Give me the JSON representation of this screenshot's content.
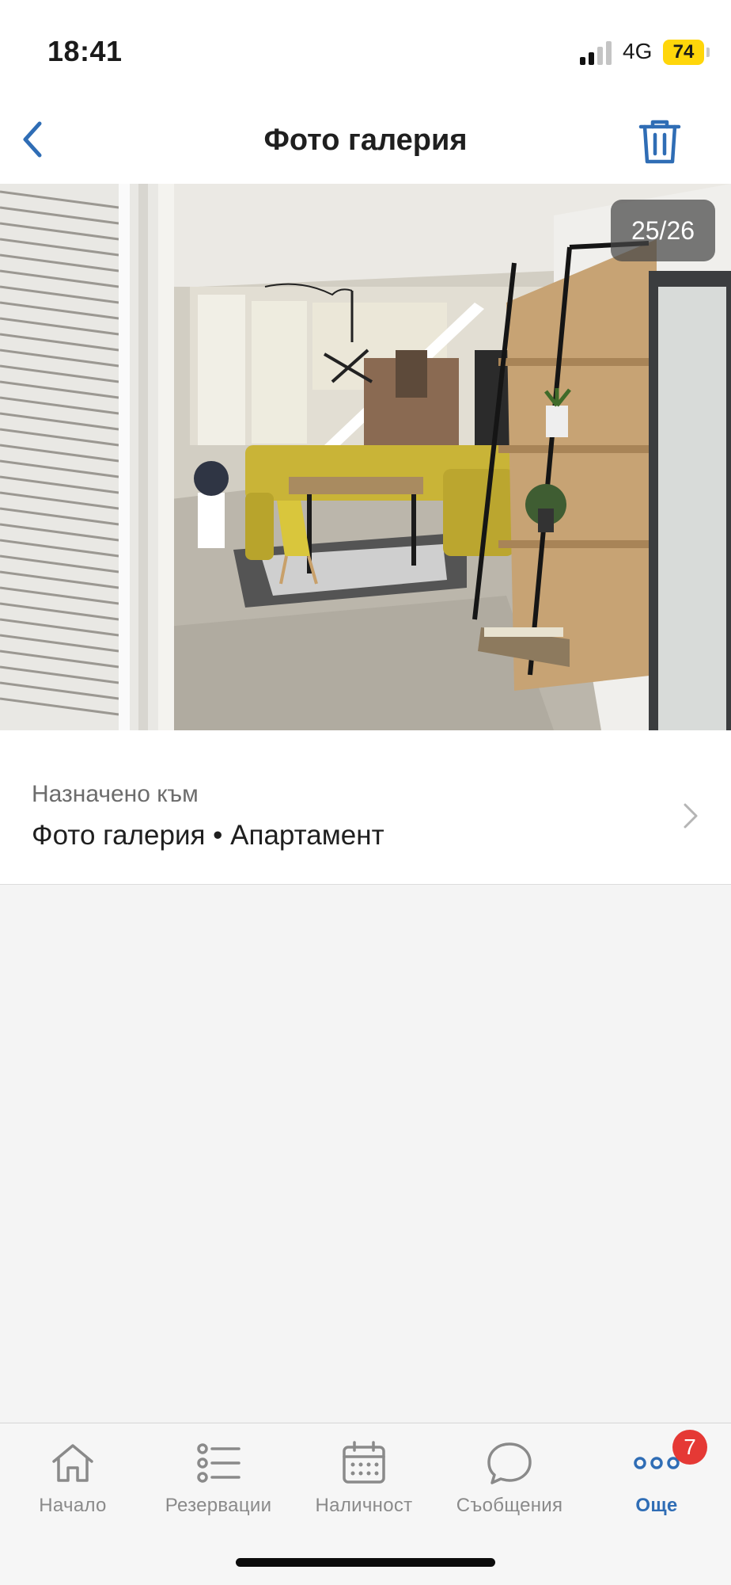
{
  "status_bar": {
    "time": "18:41",
    "network": "4G",
    "battery": "74"
  },
  "nav": {
    "title": "Фото галерия",
    "back_icon": "chevron-left-icon",
    "delete_icon": "trash-icon"
  },
  "photo": {
    "counter": "25/26"
  },
  "assignment": {
    "label": "Назначено към",
    "value": "Фото галерия • Апартамент"
  },
  "tabs": [
    {
      "label": "Начало",
      "icon": "home-icon"
    },
    {
      "label": "Резервации",
      "icon": "list-icon"
    },
    {
      "label": "Наличност",
      "icon": "calendar-icon"
    },
    {
      "label": "Съобщения",
      "icon": "chat-bubble-icon"
    },
    {
      "label": "Още",
      "icon": "more-dots-icon",
      "badge": "7",
      "active": true
    }
  ],
  "colors": {
    "accent": "#2f6db5",
    "badge": "#e53935",
    "battery": "#ffd60a"
  }
}
